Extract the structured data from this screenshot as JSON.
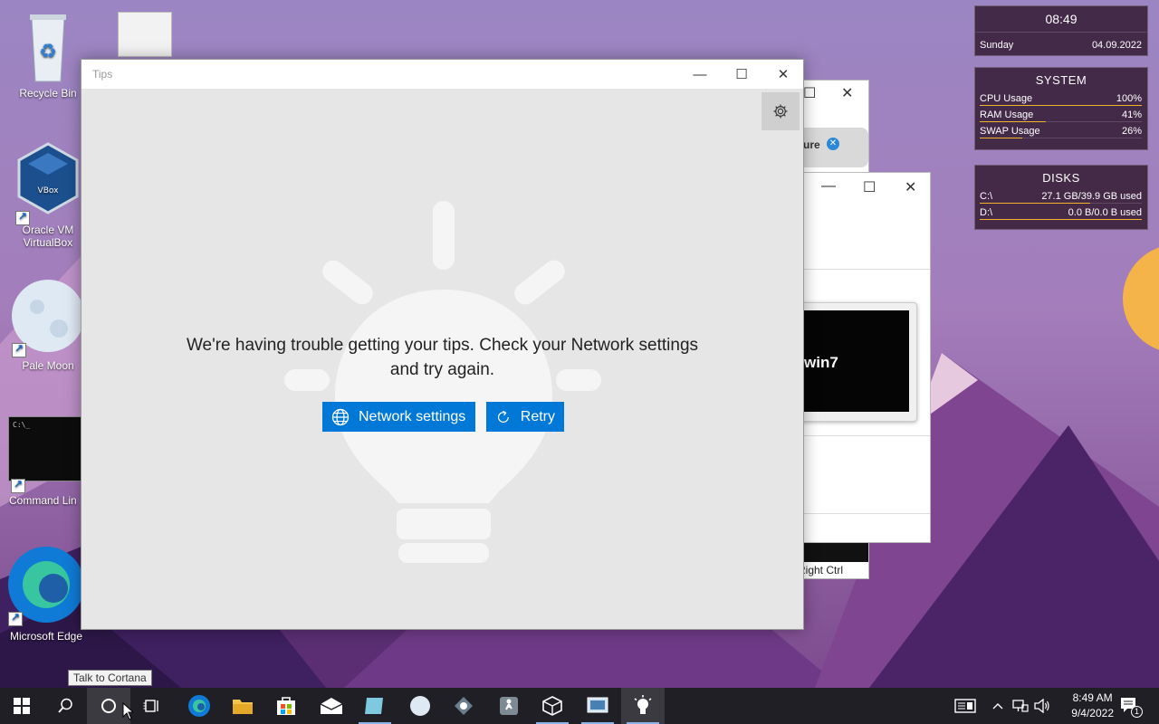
{
  "desktop": {
    "icons": [
      {
        "label": "Recycle Bin"
      },
      {
        "label": "Oracle VM\nVirtualBox"
      },
      {
        "label": "Pale Moon"
      },
      {
        "label": "Command Lin"
      },
      {
        "label": "Microsoft Edge"
      }
    ]
  },
  "widgets": {
    "clock": {
      "time": "08:49",
      "day": "Sunday",
      "date": "04.09.2022"
    },
    "system": {
      "title": "SYSTEM",
      "rows": [
        {
          "label": "CPU Usage",
          "value": "100%",
          "fill": 1.0
        },
        {
          "label": "RAM Usage",
          "value": "41%",
          "fill": 0.41
        },
        {
          "label": "SWAP Usage",
          "value": "26%",
          "fill": 0.26
        }
      ]
    },
    "disks": {
      "title": "DISKS",
      "rows": [
        {
          "label": "C:\\",
          "value": "27.1 GB/39.9 GB used",
          "fill": 0.68
        },
        {
          "label": "D:\\",
          "value": "0.0 B/0.0 B used",
          "fill": 1.0
        }
      ]
    }
  },
  "background_windows": {
    "partial_text_1": "ure",
    "vm_label": "win7",
    "status_key": "Right Ctrl"
  },
  "tips_window": {
    "title": "Tips",
    "message_line1": "We're having trouble getting your tips. Check your Network settings",
    "message_line2": "and try again.",
    "network_button": "Network settings",
    "retry_button": "Retry"
  },
  "tooltip": "Talk to Cortana",
  "taskbar": {
    "time": "8:49 AM",
    "date": "9/4/2022",
    "notification_count": "1"
  },
  "colors": {
    "accent": "#0078d7",
    "widget_bar": "#f3b32a",
    "taskbar": "#1f1f25"
  }
}
